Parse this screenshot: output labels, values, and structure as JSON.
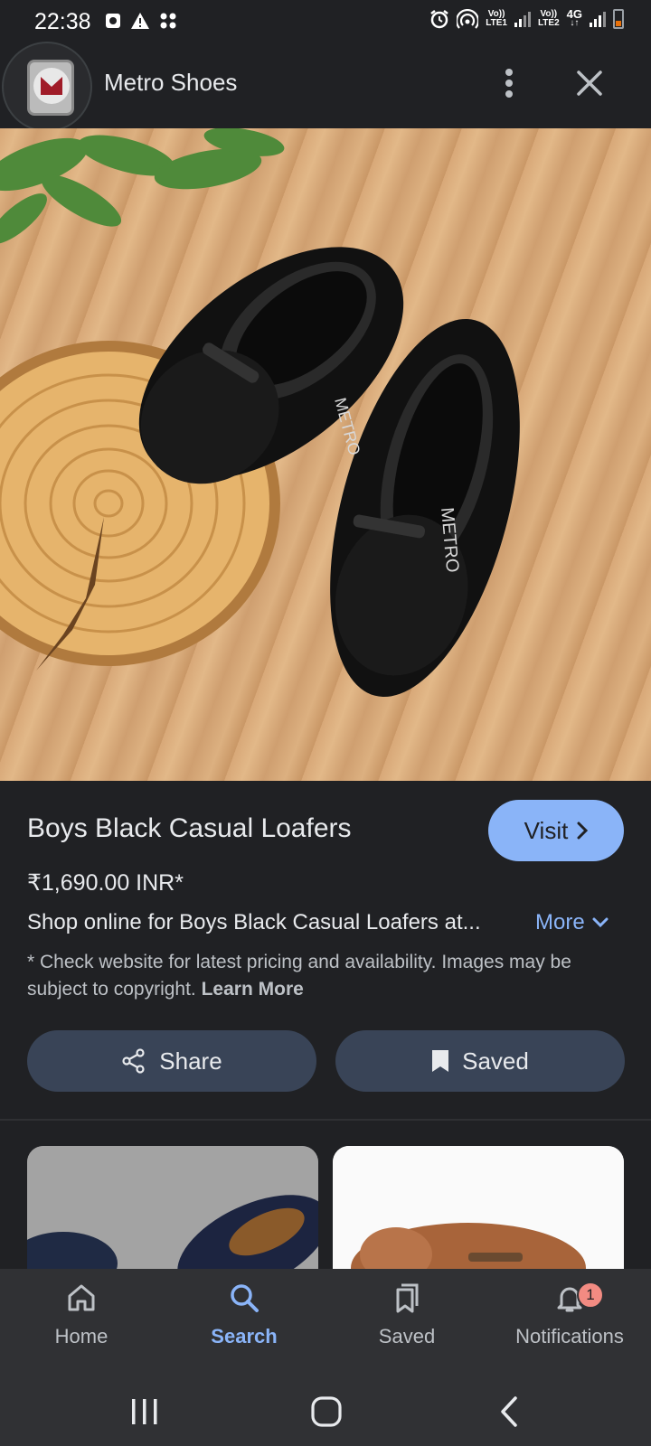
{
  "status_bar": {
    "time": "22:38",
    "net1_top": "Vo))",
    "net1_bottom": "LTE1",
    "net2_top": "Vo))",
    "net2_bottom": "LTE2",
    "net_type": "4G"
  },
  "header": {
    "site_name": "Metro Shoes",
    "icons": [
      "more-vert-icon",
      "close-icon"
    ]
  },
  "product": {
    "title": "Boys Black Casual Loafers",
    "price": "₹1,690.00 INR*",
    "description": "Shop online for Boys Black Casual Loafers at...",
    "more_label": "More",
    "disclaimer": "* Check website for latest pricing and availability. Images may be subject to copyright.",
    "learn_more": "Learn More",
    "visit_label": "Visit"
  },
  "actions": {
    "share_label": "Share",
    "saved_label": "Saved"
  },
  "bottom_nav": {
    "items": [
      {
        "label": "Home",
        "icon": "home-icon"
      },
      {
        "label": "Search",
        "icon": "search-icon",
        "active": true
      },
      {
        "label": "Saved",
        "icon": "saved-icon"
      },
      {
        "label": "Notifications",
        "icon": "bell-icon",
        "badge": "1"
      }
    ]
  },
  "colors": {
    "background": "#202124",
    "accent": "#8ab4f8",
    "pill": "#394457",
    "nav_bg": "#303134",
    "badge": "#f28b82"
  }
}
